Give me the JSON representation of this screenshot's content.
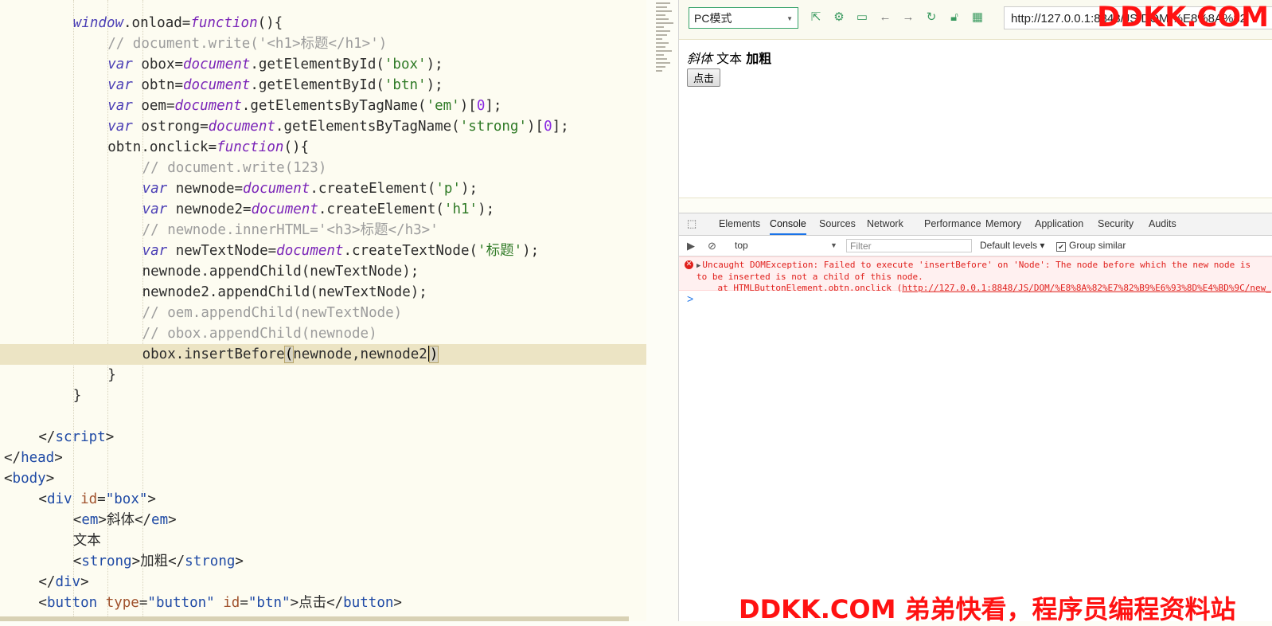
{
  "editor": {
    "lines": [
      {
        "indent": 8,
        "active": false,
        "tokens": [
          [
            "kw",
            "window"
          ],
          [
            "pl",
            ".onload="
          ],
          [
            "fn",
            "function"
          ],
          [
            "pl",
            "(){"
          ]
        ]
      },
      {
        "indent": 12,
        "active": false,
        "tokens": [
          [
            "cm",
            "// document.write('<h1>标题</h1>')"
          ]
        ]
      },
      {
        "indent": 12,
        "active": false,
        "tokens": [
          [
            "kw",
            "var"
          ],
          [
            "pl",
            " obox="
          ],
          [
            "fn",
            "document"
          ],
          [
            "pl",
            ".getElementById("
          ],
          [
            "st",
            "'box'"
          ],
          [
            "pl",
            ");"
          ]
        ]
      },
      {
        "indent": 12,
        "active": false,
        "tokens": [
          [
            "kw",
            "var"
          ],
          [
            "pl",
            " obtn="
          ],
          [
            "fn",
            "document"
          ],
          [
            "pl",
            ".getElementById("
          ],
          [
            "st",
            "'btn'"
          ],
          [
            "pl",
            ");"
          ]
        ]
      },
      {
        "indent": 12,
        "active": false,
        "tokens": [
          [
            "kw",
            "var"
          ],
          [
            "pl",
            " oem="
          ],
          [
            "fn",
            "document"
          ],
          [
            "pl",
            ".getElementsByTagName("
          ],
          [
            "st",
            "'em'"
          ],
          [
            "pl",
            ")["
          ],
          [
            "nm",
            "0"
          ],
          [
            "pl",
            "];"
          ]
        ]
      },
      {
        "indent": 12,
        "active": false,
        "tokens": [
          [
            "kw",
            "var"
          ],
          [
            "pl",
            " ostrong="
          ],
          [
            "fn",
            "document"
          ],
          [
            "pl",
            ".getElementsByTagName("
          ],
          [
            "st",
            "'strong'"
          ],
          [
            "pl",
            ")["
          ],
          [
            "nm",
            "0"
          ],
          [
            "pl",
            "];"
          ]
        ]
      },
      {
        "indent": 12,
        "active": false,
        "tokens": [
          [
            "pl",
            "obtn.onclick="
          ],
          [
            "fn",
            "function"
          ],
          [
            "pl",
            "(){"
          ]
        ]
      },
      {
        "indent": 16,
        "active": false,
        "tokens": [
          [
            "cm",
            "// document.write(123)"
          ]
        ]
      },
      {
        "indent": 16,
        "active": false,
        "tokens": [
          [
            "kw",
            "var"
          ],
          [
            "pl",
            " newnode="
          ],
          [
            "fn",
            "document"
          ],
          [
            "pl",
            ".createElement("
          ],
          [
            "st",
            "'p'"
          ],
          [
            "pl",
            ");"
          ]
        ]
      },
      {
        "indent": 16,
        "active": false,
        "tokens": [
          [
            "kw",
            "var"
          ],
          [
            "pl",
            " newnode2="
          ],
          [
            "fn",
            "document"
          ],
          [
            "pl",
            ".createElement("
          ],
          [
            "st",
            "'h1'"
          ],
          [
            "pl",
            ");"
          ]
        ]
      },
      {
        "indent": 16,
        "active": false,
        "tokens": [
          [
            "cm",
            "// newnode.innerHTML='<h3>标题</h3>'"
          ]
        ]
      },
      {
        "indent": 16,
        "active": false,
        "tokens": [
          [
            "kw",
            "var"
          ],
          [
            "pl",
            " newTextNode="
          ],
          [
            "fn",
            "document"
          ],
          [
            "pl",
            ".createTextNode("
          ],
          [
            "st",
            "'标题'"
          ],
          [
            "pl",
            ");"
          ]
        ]
      },
      {
        "indent": 16,
        "active": false,
        "tokens": [
          [
            "pl",
            "newnode.appendChild(newTextNode);"
          ]
        ]
      },
      {
        "indent": 16,
        "active": false,
        "tokens": [
          [
            "pl",
            "newnode2.appendChild(newTextNode);"
          ]
        ]
      },
      {
        "indent": 16,
        "active": false,
        "tokens": [
          [
            "cm",
            "// oem.appendChild(newTextNode)"
          ]
        ]
      },
      {
        "indent": 16,
        "active": false,
        "tokens": [
          [
            "cm",
            "// obox.appendChild(newnode)"
          ]
        ]
      },
      {
        "indent": 16,
        "active": true,
        "tokens": [
          [
            "pl",
            "obox.insertBefore"
          ],
          [
            "par",
            "("
          ],
          [
            "pl",
            "newnode,newnode2"
          ],
          [
            "caret",
            ""
          ],
          [
            "par",
            ")"
          ]
        ]
      },
      {
        "indent": 12,
        "active": false,
        "tokens": [
          [
            "pl",
            "}"
          ]
        ]
      },
      {
        "indent": 8,
        "active": false,
        "tokens": [
          [
            "pl",
            "}"
          ]
        ]
      },
      {
        "indent": 0,
        "active": false,
        "tokens": []
      },
      {
        "indent": 4,
        "active": false,
        "tokens": [
          [
            "pl",
            "</"
          ],
          [
            "tg",
            "script"
          ],
          [
            "pl",
            ">"
          ]
        ]
      },
      {
        "indent": 0,
        "active": false,
        "tokens": [
          [
            "pl",
            "</"
          ],
          [
            "tg",
            "head"
          ],
          [
            "pl",
            ">"
          ]
        ]
      },
      {
        "indent": 0,
        "active": false,
        "tokens": [
          [
            "pl",
            "<"
          ],
          [
            "tg",
            "body"
          ],
          [
            "pl",
            ">"
          ]
        ]
      },
      {
        "indent": 4,
        "active": false,
        "tokens": [
          [
            "pl",
            "<"
          ],
          [
            "tg",
            "div"
          ],
          [
            "pl",
            " "
          ],
          [
            "at",
            "id"
          ],
          [
            "pl",
            "="
          ],
          [
            "tg",
            "\"box\""
          ],
          [
            "pl",
            ">"
          ]
        ]
      },
      {
        "indent": 8,
        "active": false,
        "tokens": [
          [
            "pl",
            "<"
          ],
          [
            "tg",
            "em"
          ],
          [
            "pl",
            ">斜体</"
          ],
          [
            "tg",
            "em"
          ],
          [
            "pl",
            ">"
          ]
        ]
      },
      {
        "indent": 8,
        "active": false,
        "tokens": [
          [
            "pl",
            "文本"
          ]
        ]
      },
      {
        "indent": 8,
        "active": false,
        "tokens": [
          [
            "pl",
            "<"
          ],
          [
            "tg",
            "strong"
          ],
          [
            "pl",
            ">加粗</"
          ],
          [
            "tg",
            "strong"
          ],
          [
            "pl",
            ">"
          ]
        ]
      },
      {
        "indent": 4,
        "active": false,
        "tokens": [
          [
            "pl",
            "</"
          ],
          [
            "tg",
            "div"
          ],
          [
            "pl",
            ">"
          ]
        ]
      },
      {
        "indent": 4,
        "active": false,
        "tokens": [
          [
            "pl",
            "<"
          ],
          [
            "tg",
            "button"
          ],
          [
            "pl",
            " "
          ],
          [
            "at",
            "type"
          ],
          [
            "pl",
            "="
          ],
          [
            "tg",
            "\"button\""
          ],
          [
            "pl",
            " "
          ],
          [
            "at",
            "id"
          ],
          [
            "pl",
            "="
          ],
          [
            "tg",
            "\"btn\""
          ],
          [
            "pl",
            ">点击</"
          ],
          [
            "tg",
            "button"
          ],
          [
            "pl",
            ">"
          ]
        ]
      }
    ]
  },
  "browser": {
    "mode": "PC模式",
    "url": "http://127.0.0.1:8848/JS/DOM/%E8%8A%82",
    "preview": {
      "em": "斜体",
      "text": "文本",
      "strong": "加粗",
      "button": "点击"
    },
    "devtools": {
      "tabs": [
        "Elements",
        "Console",
        "Sources",
        "Network",
        "Performance",
        "Memory",
        "Application",
        "Security",
        "Audits"
      ],
      "active_tab": "Console",
      "context": "top",
      "filter_placeholder": "Filter",
      "levels": "Default levels",
      "group_similar": "Group similar",
      "error_line1": "Uncaught DOMException: Failed to execute 'insertBefore' on 'Node': The node before which the new node is",
      "error_line2": "to be inserted is not a child of this node.",
      "error_line3_prefix": "    at HTMLButtonElement.obtn.onclick (",
      "error_link": "http://127.0.0.1:8848/JS/DOM/%E8%8A%82%E7%82%B9%E6%93%8D%E4%BD%9C/new_",
      "prompt": ">"
    }
  },
  "watermark": {
    "top": "DDKK.COM",
    "bottom": "DDKK.COM 弟弟快看，程序员编程资料站"
  }
}
